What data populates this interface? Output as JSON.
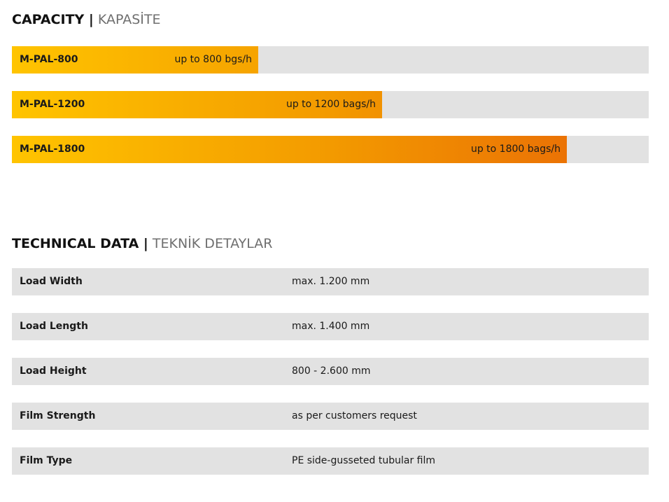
{
  "capacity": {
    "title_bold": "CAPACITY |",
    "title_light": "KAPASİTE"
  },
  "technical": {
    "title_bold": "TECHNICAL DATA |",
    "title_light": "TEKNİK DETAYLAR",
    "rows": [
      {
        "label": "Load Width",
        "value": "max. 1.200 mm"
      },
      {
        "label": "Load Length",
        "value": "max. 1.400 mm"
      },
      {
        "label": "Load Height",
        "value": "800 - 2.600 mm"
      },
      {
        "label": "Film Strength",
        "value": "as per customers request"
      },
      {
        "label": "Film Type",
        "value": "PE side-gusseted tubular film"
      }
    ]
  },
  "chart_data": {
    "type": "bar",
    "orientation": "horizontal",
    "categories": [
      "M-PAL-800",
      "M-PAL-1200",
      "M-PAL-1800"
    ],
    "values": [
      800,
      1200,
      1800
    ],
    "value_labels": [
      "up to 800 bgs/h",
      "up to 1200 bags/h",
      "up to 1800 bags/h"
    ],
    "xlim": [
      0,
      2066
    ],
    "grid": false,
    "colors": {
      "fill_start": "#ffc400",
      "fill_mid": "#f39a00",
      "fill_end": "#e86506",
      "track": "#e2e2e2"
    }
  }
}
